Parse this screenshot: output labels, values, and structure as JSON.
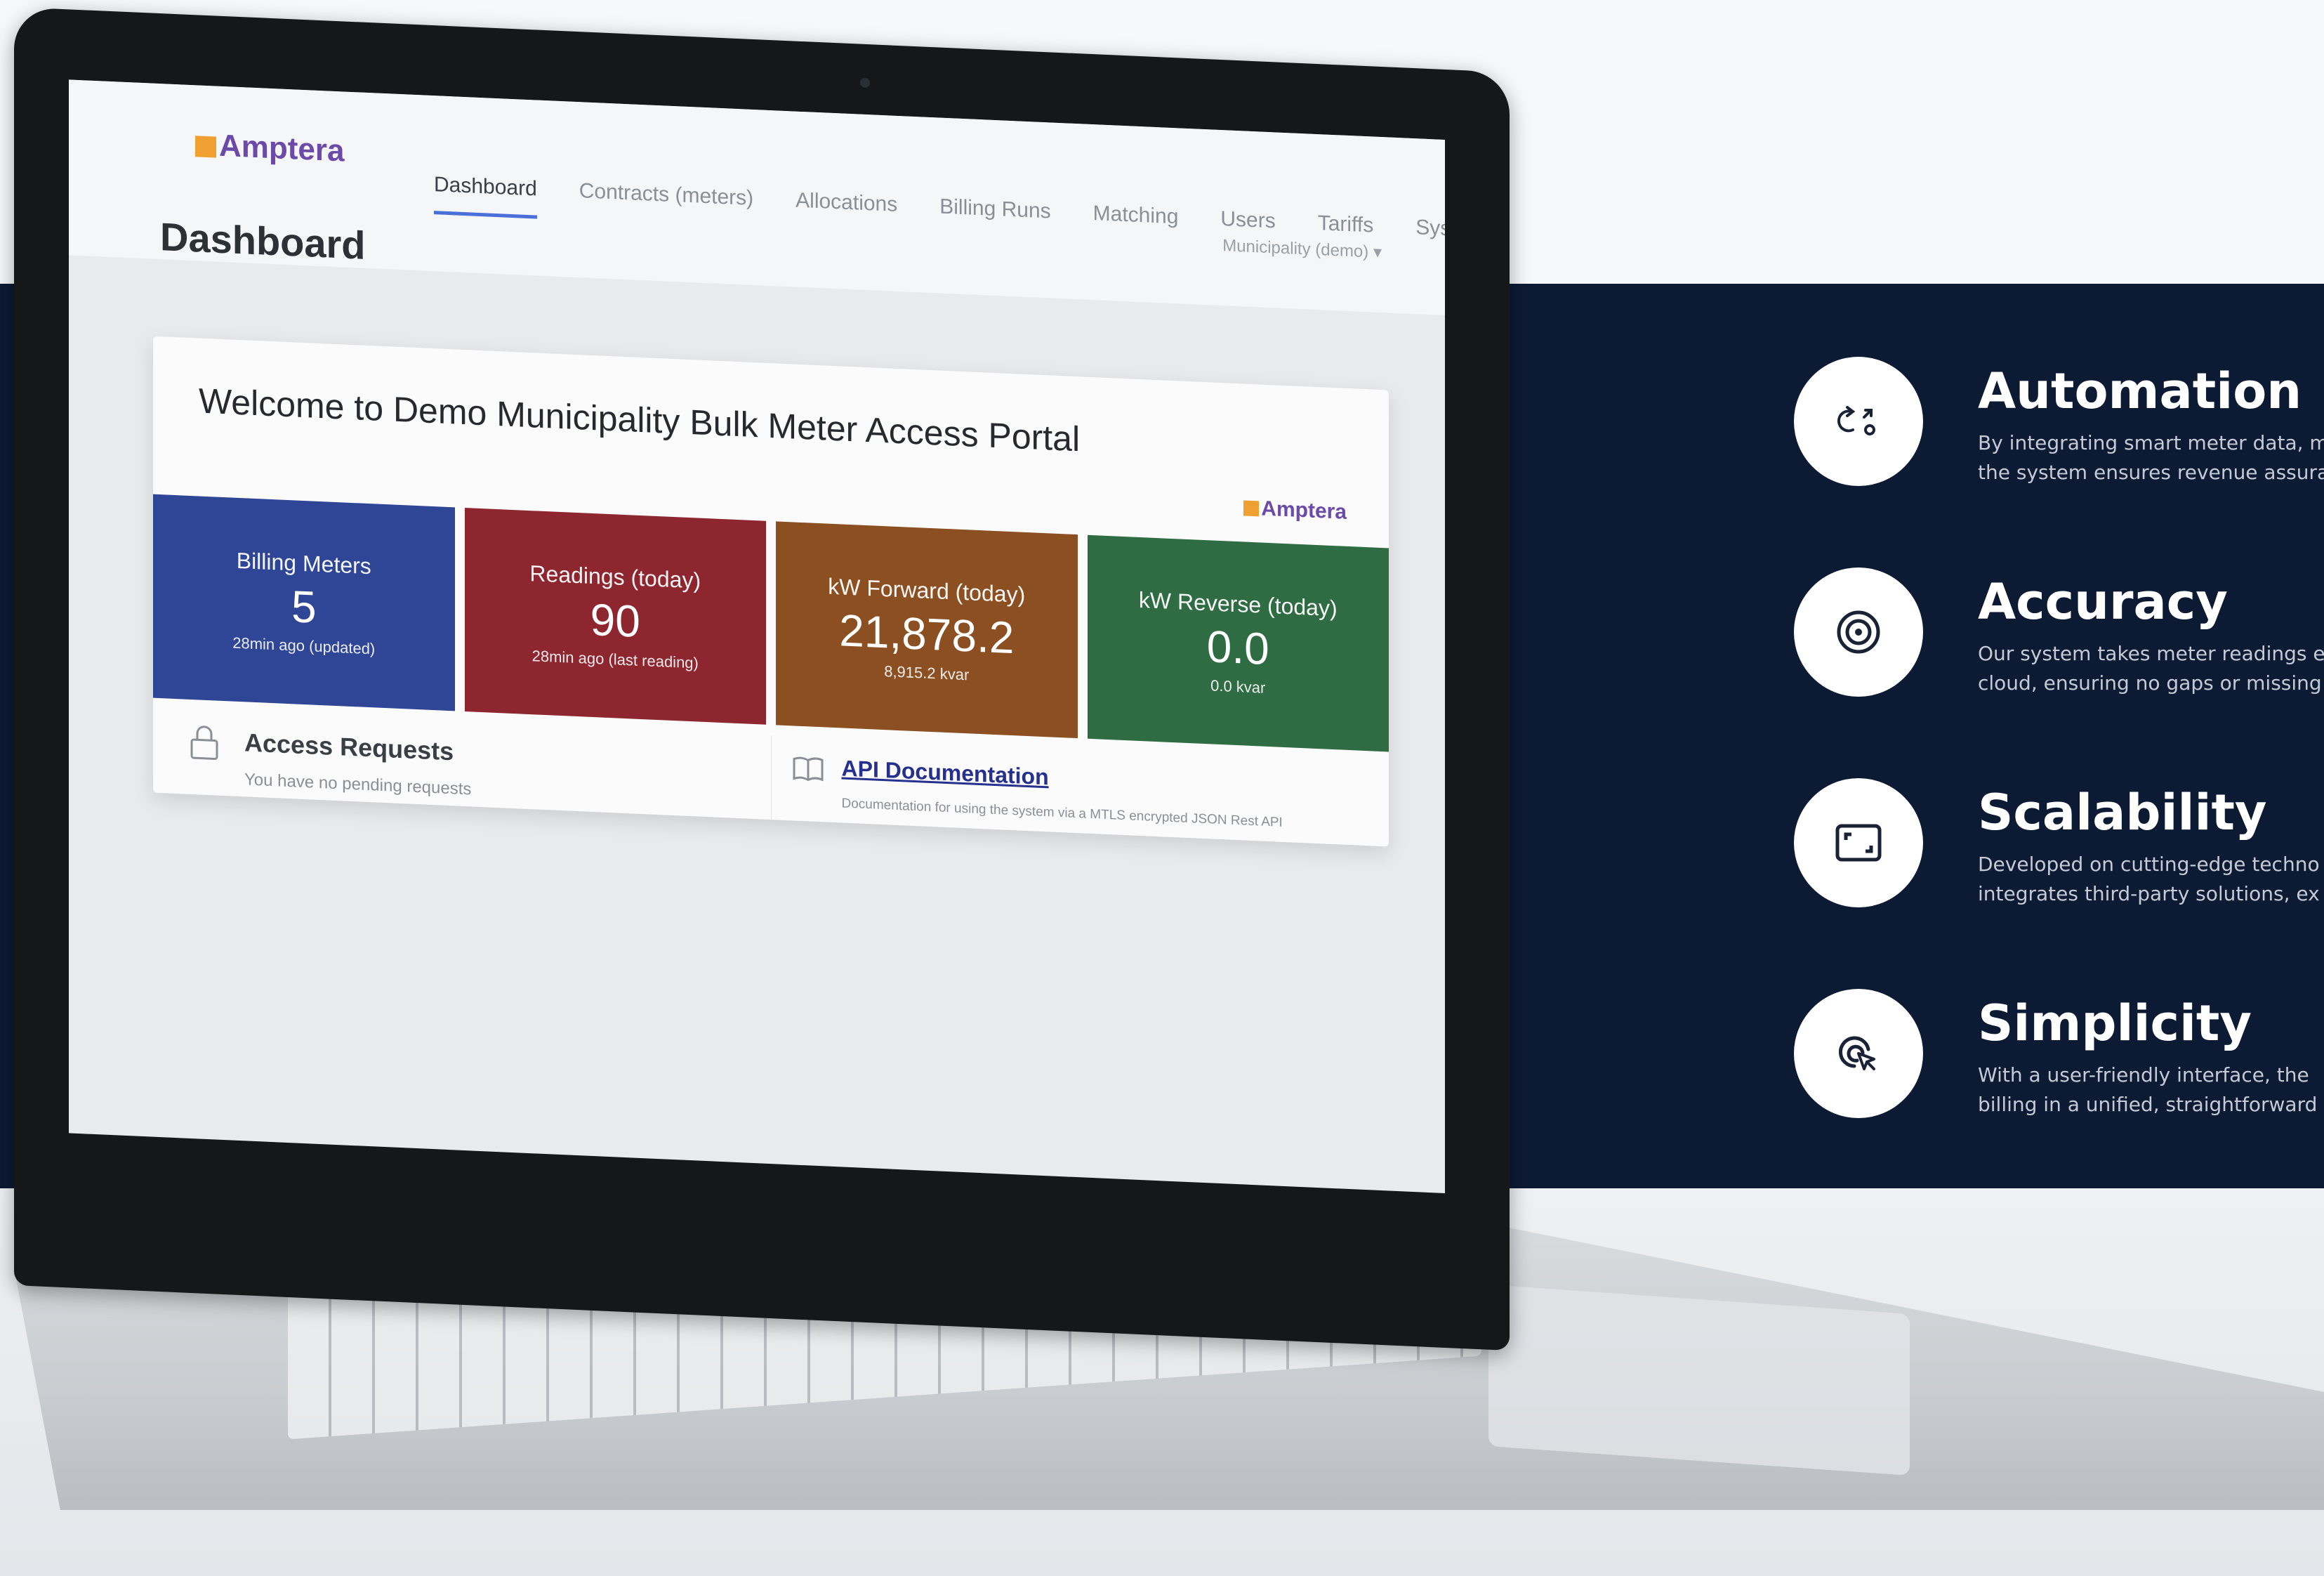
{
  "app": {
    "logo_text": "Amptera",
    "page_title": "Dashboard",
    "nav": [
      "Dashboard",
      "Contracts (meters)",
      "Allocations",
      "Billing Runs",
      "Matching",
      "Users",
      "Tariffs",
      "System"
    ],
    "municipality_selector": "Municipality (demo)",
    "welcome": "Welcome to Demo Municipality Bulk Meter Access Portal",
    "card_logo_text": "Amptera",
    "tiles": [
      {
        "label": "Billing Meters",
        "value": "5",
        "sub": "28min ago (updated)",
        "color": "#2f4596"
      },
      {
        "label": "Readings (today)",
        "value": "90",
        "sub": "28min ago (last reading)",
        "color": "#8e2630"
      },
      {
        "label": "kW Forward (today)",
        "value": "21,878.2",
        "sub": "8,915.2 kvar",
        "color": "#8b4f22"
      },
      {
        "label": "kW Reverse (today)",
        "value": "0.0",
        "sub": "0.0 kvar",
        "color": "#2f6b43"
      }
    ],
    "access_requests": {
      "icon": "lock-icon",
      "title": "Access Requests",
      "sub": "You have no pending requests"
    },
    "api_docs": {
      "icon": "book-icon",
      "link": "API Documentation",
      "sub": "Documentation for using the system via a MTLS encrypted JSON Rest API"
    }
  },
  "features": [
    {
      "icon": "automation-icon",
      "title": "Automation",
      "line1": "By integrating smart meter data, m",
      "line2": "the system ensures revenue assura"
    },
    {
      "icon": "target-icon",
      "title": "Accuracy",
      "line1": "Our system takes meter readings e",
      "line2": "cloud, ensuring no gaps or missing"
    },
    {
      "icon": "expand-icon",
      "title": "Scalability",
      "line1": "Developed on cutting-edge techno",
      "line2": "integrates third-party solutions, ex"
    },
    {
      "icon": "click-icon",
      "title": "Simplicity",
      "line1": "With a user-friendly interface, the",
      "line2": "billing in a unified, straightforward"
    }
  ],
  "colors": {
    "band": "#0c1a33",
    "accent_nav": "#4a6fd8"
  }
}
